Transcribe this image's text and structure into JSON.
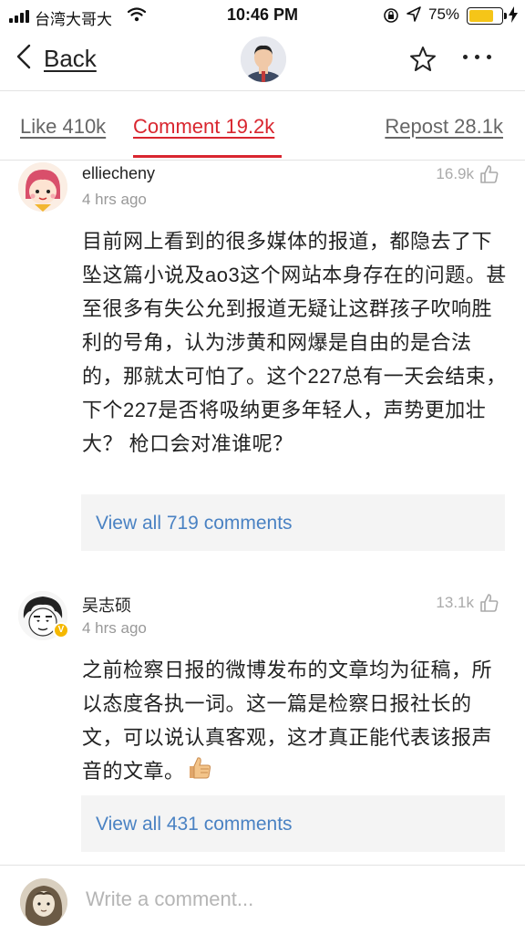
{
  "status_bar": {
    "carrier": "台湾大哥大",
    "time": "10:46 PM",
    "battery": "75%",
    "battery_level": 0.75,
    "battery_color": "#f5c518"
  },
  "header": {
    "back_label": "Back",
    "icons": [
      "chevron-left-icon",
      "star-icon",
      "more-icon"
    ]
  },
  "tabs": [
    {
      "label": "Like 410k"
    },
    {
      "label": "Comment 19.2k",
      "active": true
    },
    {
      "label": "Repost 28.1k"
    }
  ],
  "accent_color": "#d9262f",
  "link_color": "#4a82c3",
  "comments": [
    {
      "user": "elliecheny",
      "time": "4 hrs ago",
      "likes": "16.9k",
      "text": "目前网上看到的很多媒体的报道，都隐去了下坠这篇小说及ao3这个网站本身存在的问题。甚至很多有失公允到报道无疑让这群孩子吹响胜利的号角，认为涉黄和网爆是自由的是合法的，那就太可怕了。这个227总有一天会结束，下个227是否将吸纳更多年轻人，声势更加壮大？ 枪口会对准谁呢？",
      "view_all": "View all 719 comments"
    },
    {
      "user": "吴志硕",
      "time": "4 hrs ago",
      "likes": "13.1k",
      "verified": true,
      "text": "之前检察日报的微博发布的文章均为征稿，所以态度各执一词。这一篇是检察日报社长的文，可以说认真客观，这才真正能代表该报声音的文章。",
      "view_all": "View all 431 comments"
    }
  ],
  "composer": {
    "placeholder": "Write a comment..."
  }
}
